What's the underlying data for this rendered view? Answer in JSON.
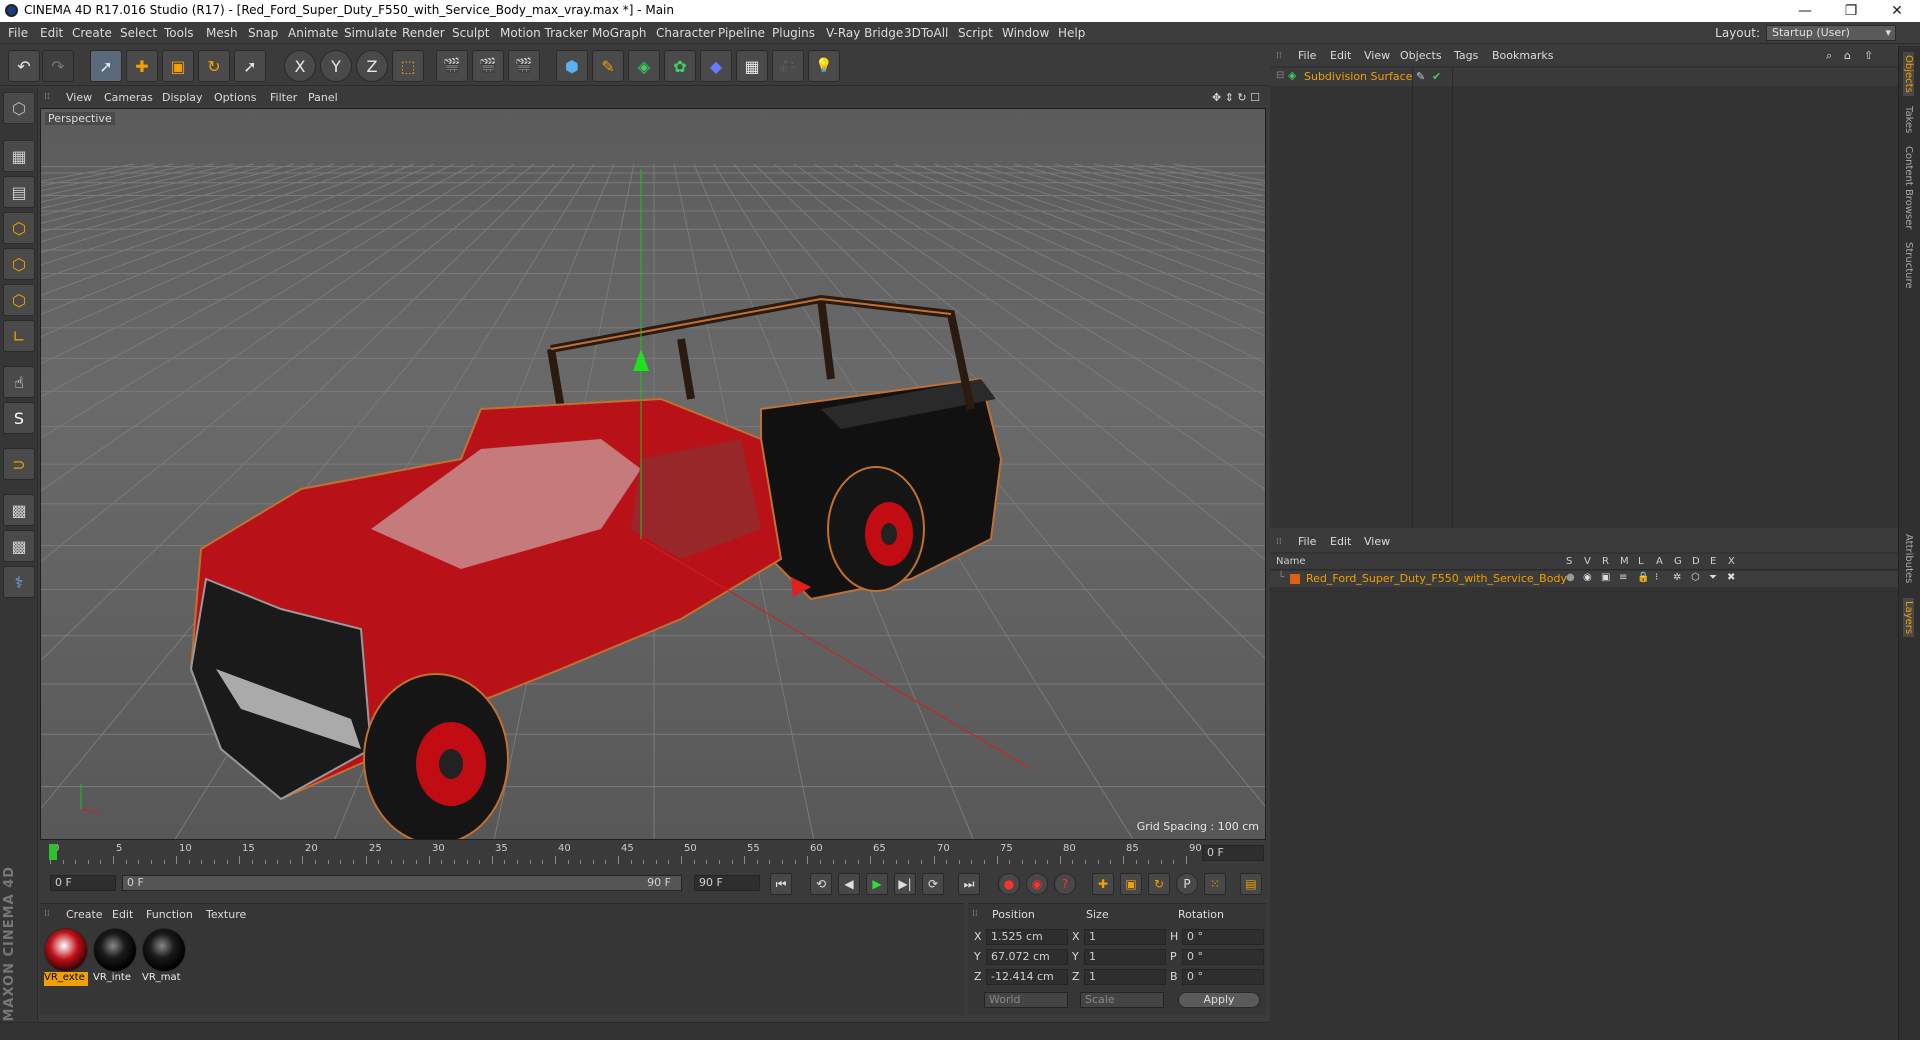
{
  "window": {
    "title": "CINEMA 4D R17.016 Studio (R17) - [Red_Ford_Super_Duty_F550_with_Service_Body_max_vray.max *] - Main",
    "minimize": "—",
    "restore": "❐",
    "close": "✕"
  },
  "menubar": {
    "items": [
      "File",
      "Edit",
      "Create",
      "Select",
      "Tools",
      "Mesh",
      "Snap",
      "Animate",
      "Simulate",
      "Render",
      "Sculpt",
      "Motion Tracker",
      "MoGraph",
      "Character",
      "Pipeline",
      "Plugins",
      "V-Ray Bridge",
      "3DToAll",
      "Script",
      "Window",
      "Help"
    ],
    "layout_label": "Layout:",
    "layout_value": "Startup (User)"
  },
  "toolbar": {
    "undo": "↶",
    "redo": "↷",
    "live_select": "➚",
    "move": "✚",
    "scale": "▣",
    "rotate": "↻",
    "recent": "➚",
    "x_axis": "X",
    "y_axis": "Y",
    "z_axis": "Z",
    "coord_system": "⬚",
    "render_view": "🎬",
    "render_picture": "🎬",
    "render_settings": "🎬",
    "cube": "⬢",
    "pen": "✎",
    "subdivision": "◈",
    "mograph": "✿",
    "deformer": "◆",
    "floor": "▦",
    "camera": "🎥",
    "light": "💡"
  },
  "lefttools": [
    "⬡",
    "▦",
    "▤",
    "⬡",
    "⬡",
    "⬡",
    "∟",
    "☝",
    "S",
    "⊃",
    "▩",
    "▩",
    "⚕"
  ],
  "viewport": {
    "menu": [
      "View",
      "Cameras",
      "Display",
      "Options",
      "Filter",
      "Panel"
    ],
    "label": "Perspective",
    "grid_spacing": "Grid Spacing : 100 cm",
    "nav_icons": "✥ ⇕ ↻ ☐"
  },
  "timeline": {
    "ticks": [
      "0",
      "5",
      "10",
      "15",
      "20",
      "25",
      "30",
      "35",
      "40",
      "45",
      "50",
      "55",
      "60",
      "65",
      "70",
      "75",
      "80",
      "85",
      "90"
    ],
    "current_frame": "0 F"
  },
  "playback": {
    "start": "0 F",
    "range_start": "0 F",
    "range_end": "90 F",
    "end": "90 F",
    "buttons": [
      "⏮",
      "⟲",
      "◀",
      "▶",
      "▶|",
      "⟳",
      "⏭"
    ]
  },
  "materials": {
    "menu": [
      "Create",
      "Edit",
      "Function",
      "Texture"
    ],
    "items": [
      {
        "label": "VR_exte"
      },
      {
        "label": "VR_inte"
      },
      {
        "label": "VR_mat"
      }
    ]
  },
  "coords": {
    "headers": [
      "Position",
      "Size",
      "Rotation"
    ],
    "rows": [
      {
        "axis": "X",
        "pos": "1.525 cm",
        "saxis": "X",
        "size": "1",
        "raxis": "H",
        "rot": "0 °"
      },
      {
        "axis": "Y",
        "pos": "67.072 cm",
        "saxis": "Y",
        "size": "1",
        "raxis": "P",
        "rot": "0 °"
      },
      {
        "axis": "Z",
        "pos": "-12.414 cm",
        "saxis": "Z",
        "size": "1",
        "raxis": "B",
        "rot": "0 °"
      }
    ],
    "space": "World",
    "mode": "Scale",
    "apply": "Apply"
  },
  "objects": {
    "menu": [
      "File",
      "Edit",
      "View",
      "Objects",
      "Tags",
      "Bookmarks"
    ],
    "items": [
      {
        "name": "Subdivision Surface"
      }
    ]
  },
  "layers": {
    "menu": [
      "File",
      "Edit",
      "View"
    ],
    "columns": [
      "Name",
      "S",
      "V",
      "R",
      "M",
      "L",
      "A",
      "G",
      "D",
      "E",
      "X"
    ],
    "items": [
      {
        "name": "Red_Ford_Super_Duty_F550_with_Service_Body"
      }
    ]
  },
  "sidetabs": [
    "Objects",
    "Takes",
    "Content Browser",
    "Structure",
    "Attributes",
    "Layers"
  ],
  "brand": "MAXON CINEMA 4D",
  "colors": {
    "accent_orange": "#f0a000",
    "car_red": "#c0141a"
  }
}
